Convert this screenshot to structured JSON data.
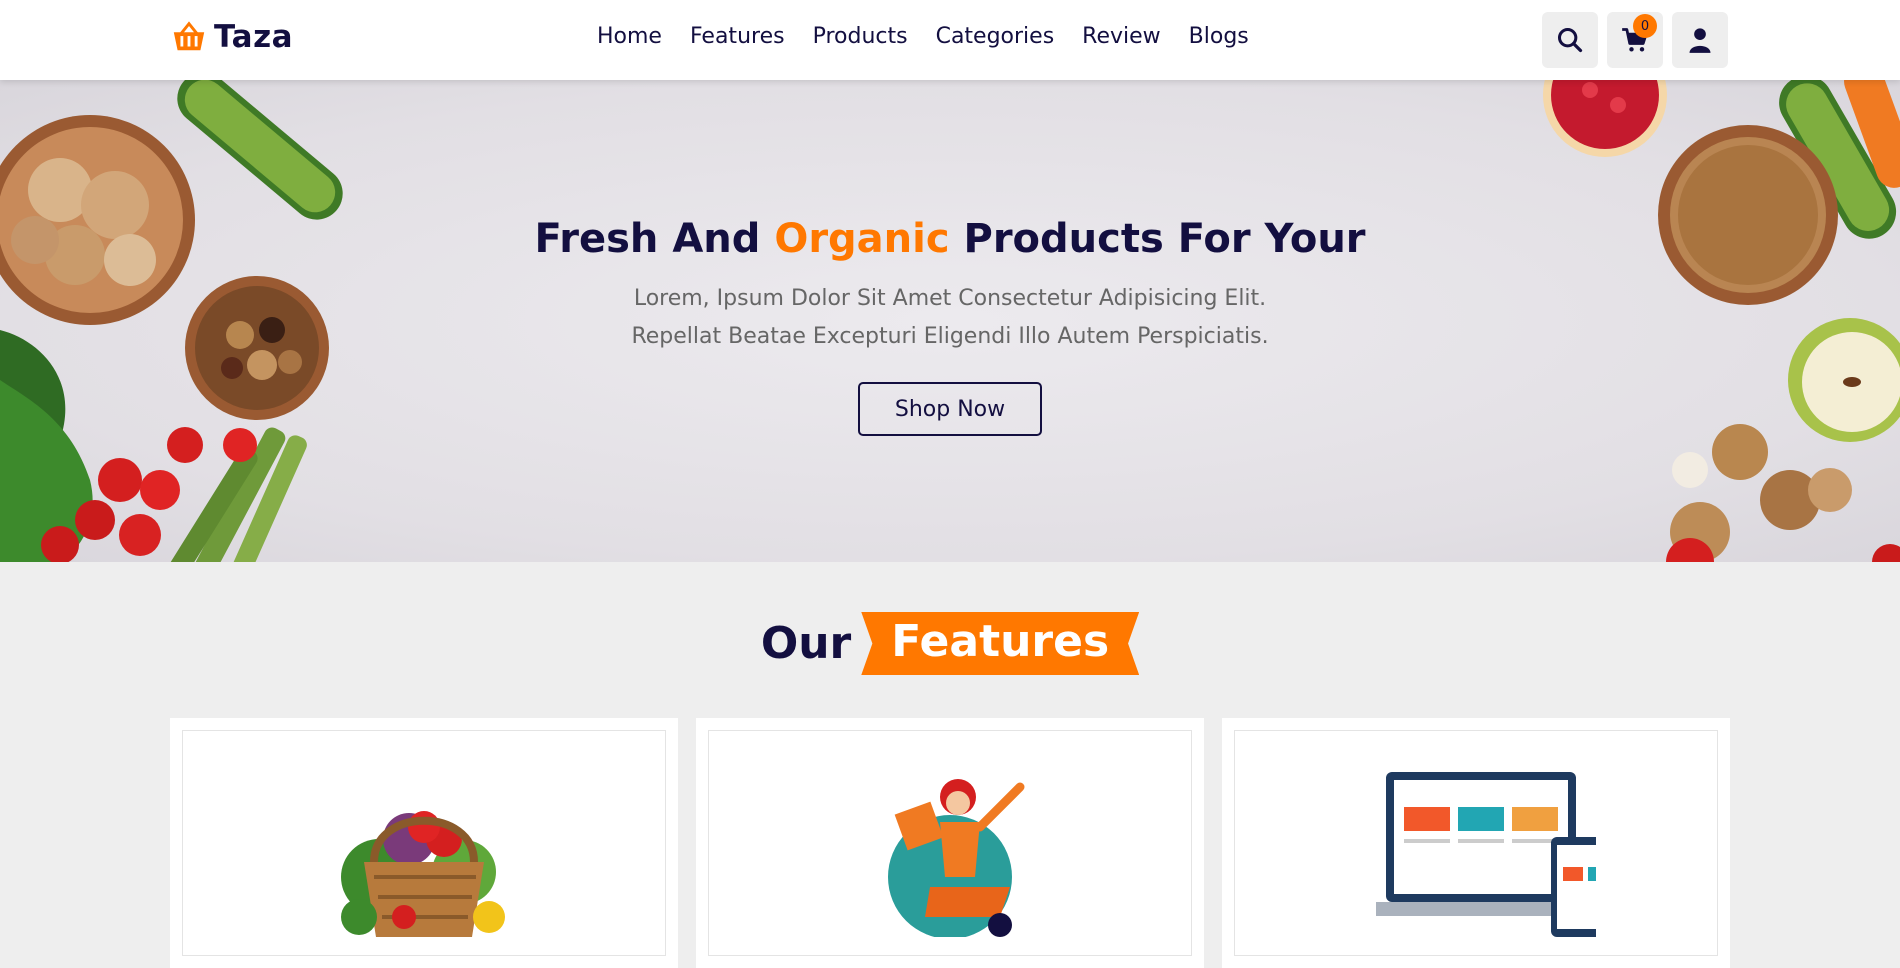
{
  "brand": {
    "name": "Taza",
    "icon": "basket-icon",
    "accent": "#ff7800",
    "dark": "#130f40"
  },
  "nav": [
    {
      "label": "Home"
    },
    {
      "label": "Features"
    },
    {
      "label": "Products"
    },
    {
      "label": "Categories"
    },
    {
      "label": "Review"
    },
    {
      "label": "Blogs"
    }
  ],
  "header_icons": {
    "search": "search-icon",
    "cart": "cart-icon",
    "cart_count": "0",
    "user": "user-icon"
  },
  "hero": {
    "title_before": "Fresh And ",
    "title_accent": "Organic",
    "title_after": " Products For Your",
    "subtitle": "Lorem, Ipsum Dolor Sit Amet Consectetur Adipisicing Elit. Repellat Beatae Excepturi Eligendi Illo Autem Perspiciatis.",
    "button": "Shop Now"
  },
  "features": {
    "heading_plain": "Our",
    "heading_highlight": "Features",
    "cards": [
      {
        "image": "vegetable-basket-image"
      },
      {
        "image": "delivery-scooter-image"
      },
      {
        "image": "devices-image"
      }
    ]
  }
}
